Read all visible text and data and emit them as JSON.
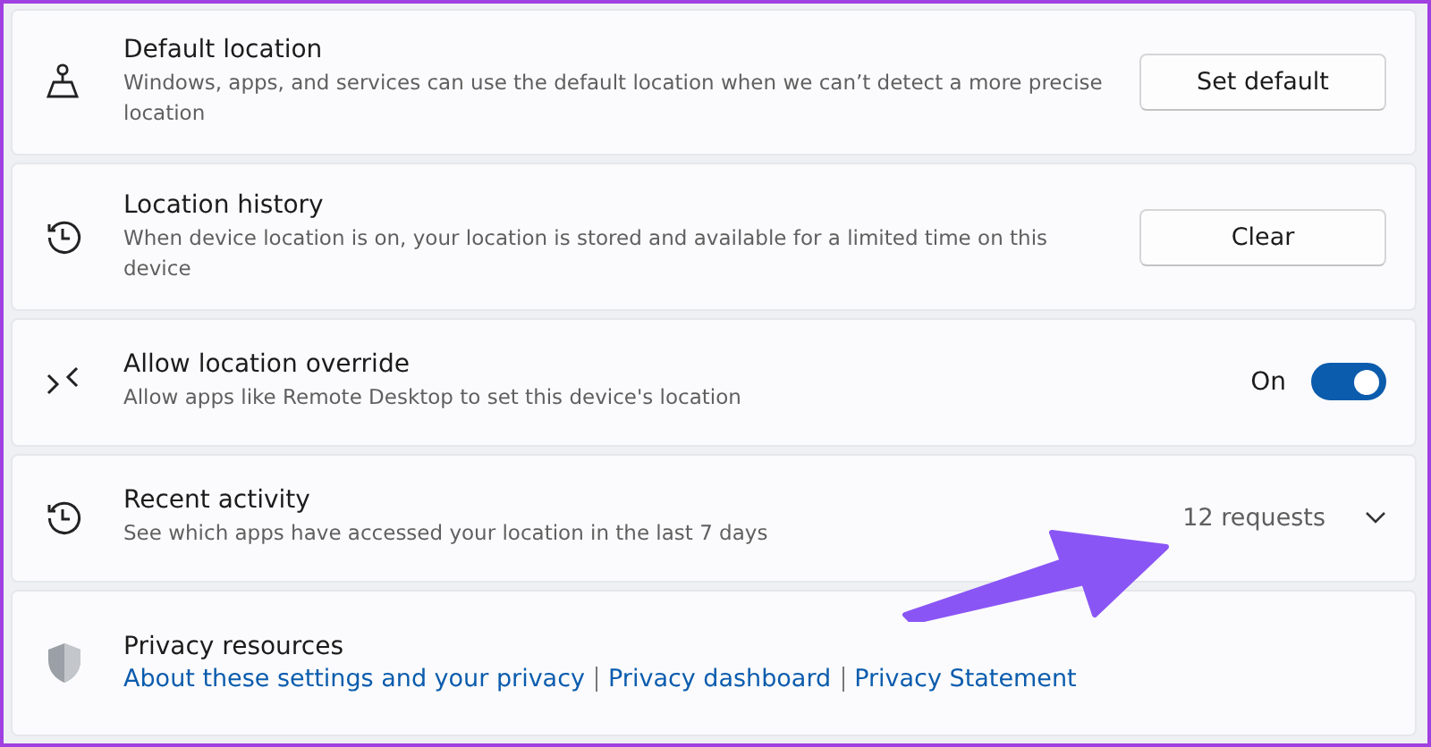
{
  "settings": [
    {
      "kind": "button",
      "title": "Default location",
      "description": "Windows, apps, and services can use the default location when we can’t detect a more precise location",
      "button": "Set default"
    },
    {
      "kind": "button",
      "title": "Location history",
      "description": "When device location is on, your location is stored and available for a limited time on this device",
      "button": "Clear"
    },
    {
      "kind": "toggle",
      "title": "Allow location override",
      "description": "Allow apps like Remote Desktop to set this device's location",
      "state_label": "On",
      "on": true
    },
    {
      "kind": "expand",
      "title": "Recent activity",
      "description": "See which apps have accessed your location in the last 7 days",
      "summary": "12 requests",
      "expanded": false
    },
    {
      "kind": "links",
      "title": "Privacy resources",
      "links": [
        "About these settings and your privacy",
        "Privacy dashboard",
        "Privacy Statement"
      ]
    }
  ],
  "annotation": {
    "kind": "arrow"
  }
}
